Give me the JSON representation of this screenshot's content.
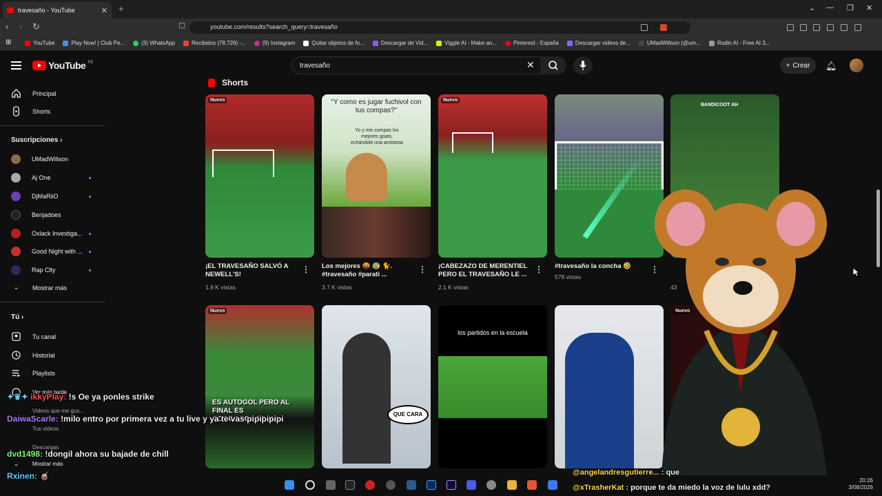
{
  "browser": {
    "tab_title": "travesaño - YouTube",
    "url": "youtube.com/results?search_query=travesaño",
    "bookmarks": [
      "YouTube",
      "Play Now! | Club Pe...",
      "(3) WhatsApp",
      "Recibidos (78.726) -...",
      "(9) Instagram",
      "Quitar objetos de fo...",
      "Descargar de Vid...",
      "Viggle AI - Make an...",
      "Pinterest - España",
      "Descargar videos de...",
      "UMadWillson (@um...",
      "Rodin AI - Free AI 3..."
    ]
  },
  "youtube": {
    "logo_text": "YouTube",
    "logo_region": "PE",
    "search_value": "travesaño",
    "create_label": "Crear"
  },
  "sidebar": {
    "home": "Principal",
    "shorts": "Shorts",
    "subs_header": "Suscripciones",
    "subs": [
      "UMadWillson",
      "Aj One",
      "DjMaRiiO",
      "Benjadoes",
      "Oxlack Investiga...",
      "Good Night with ...",
      "Rap Clty"
    ],
    "show_more": "Mostrar más",
    "you_header": "Tú",
    "you_items": [
      "Tu canal",
      "Historial",
      "Playlists",
      "Ver más tarde",
      "Videos que me gus...",
      "Tus videos",
      "Descargas"
    ],
    "show_more2": "Mostrar más"
  },
  "shorts": {
    "section_title": "Shorts",
    "row1": [
      {
        "badge": "Nuevo",
        "title": "¡EL TRAVESAÑO SALVÓ A NEWELL'S!",
        "views": "1.9 K vistas",
        "caption": ""
      },
      {
        "badge": "",
        "title": "Los mejores 🤬 😰 🐈. #travesaño #parati ...",
        "views": "3.7 K vistas",
        "caption": "\"Y como es jugar fuchivol con tus compas?\"",
        "subcaption": "Yo y mis compas los mejores goats, echándole una amistosa"
      },
      {
        "badge": "Nuevo",
        "title": "¡CABEZAZO DE MERENTIEL PERO EL TRAVESAÑO LE ...",
        "views": "2.1 K vistas",
        "caption": ""
      },
      {
        "badge": "",
        "title": "#travesaño la concha 🤣",
        "views": "578 vistas",
        "caption": ""
      },
      {
        "badge": "",
        "title": "",
        "views": "43",
        "caption": "BANDICOOT AH"
      }
    ],
    "row2": [
      {
        "badge": "Nuevo",
        "caption": "ES AUTOGOL PERO AL FINAL ES GOOOOOOOOOOL!"
      },
      {
        "badge": "",
        "caption": "QUE CARA"
      },
      {
        "badge": "",
        "caption": "los partidos en la escuela"
      },
      {
        "badge": "",
        "caption": ""
      },
      {
        "badge": "Nuevo",
        "caption": ""
      }
    ]
  },
  "chat": [
    {
      "user": "ikkyPlay:",
      "msg": "!s Oe ya ponles strike",
      "color": "#ff4d4d"
    },
    {
      "user": "DaiwaScarle:",
      "msg": "!milo entro por primera vez a tu live y ya te vas pipipipipi",
      "color": "#b27cff"
    },
    {
      "user": "dvd1498:",
      "msg": "!dongil ahora su bajade de chill",
      "color": "#7dff7d"
    },
    {
      "user": "Rxinen:",
      "msg": "🧉",
      "color": "#5ad1ff"
    },
    {
      "user": "@angelandresgutierre...",
      "msg": ": que",
      "color": "#ffd84d"
    },
    {
      "user": "@xTrasherKat",
      "msg": ": porque te da miedo la voz de lulu xdd?",
      "color": "#ffd84d"
    }
  ],
  "taskbar": {
    "time": "20:26",
    "date": "3/08/2026"
  }
}
